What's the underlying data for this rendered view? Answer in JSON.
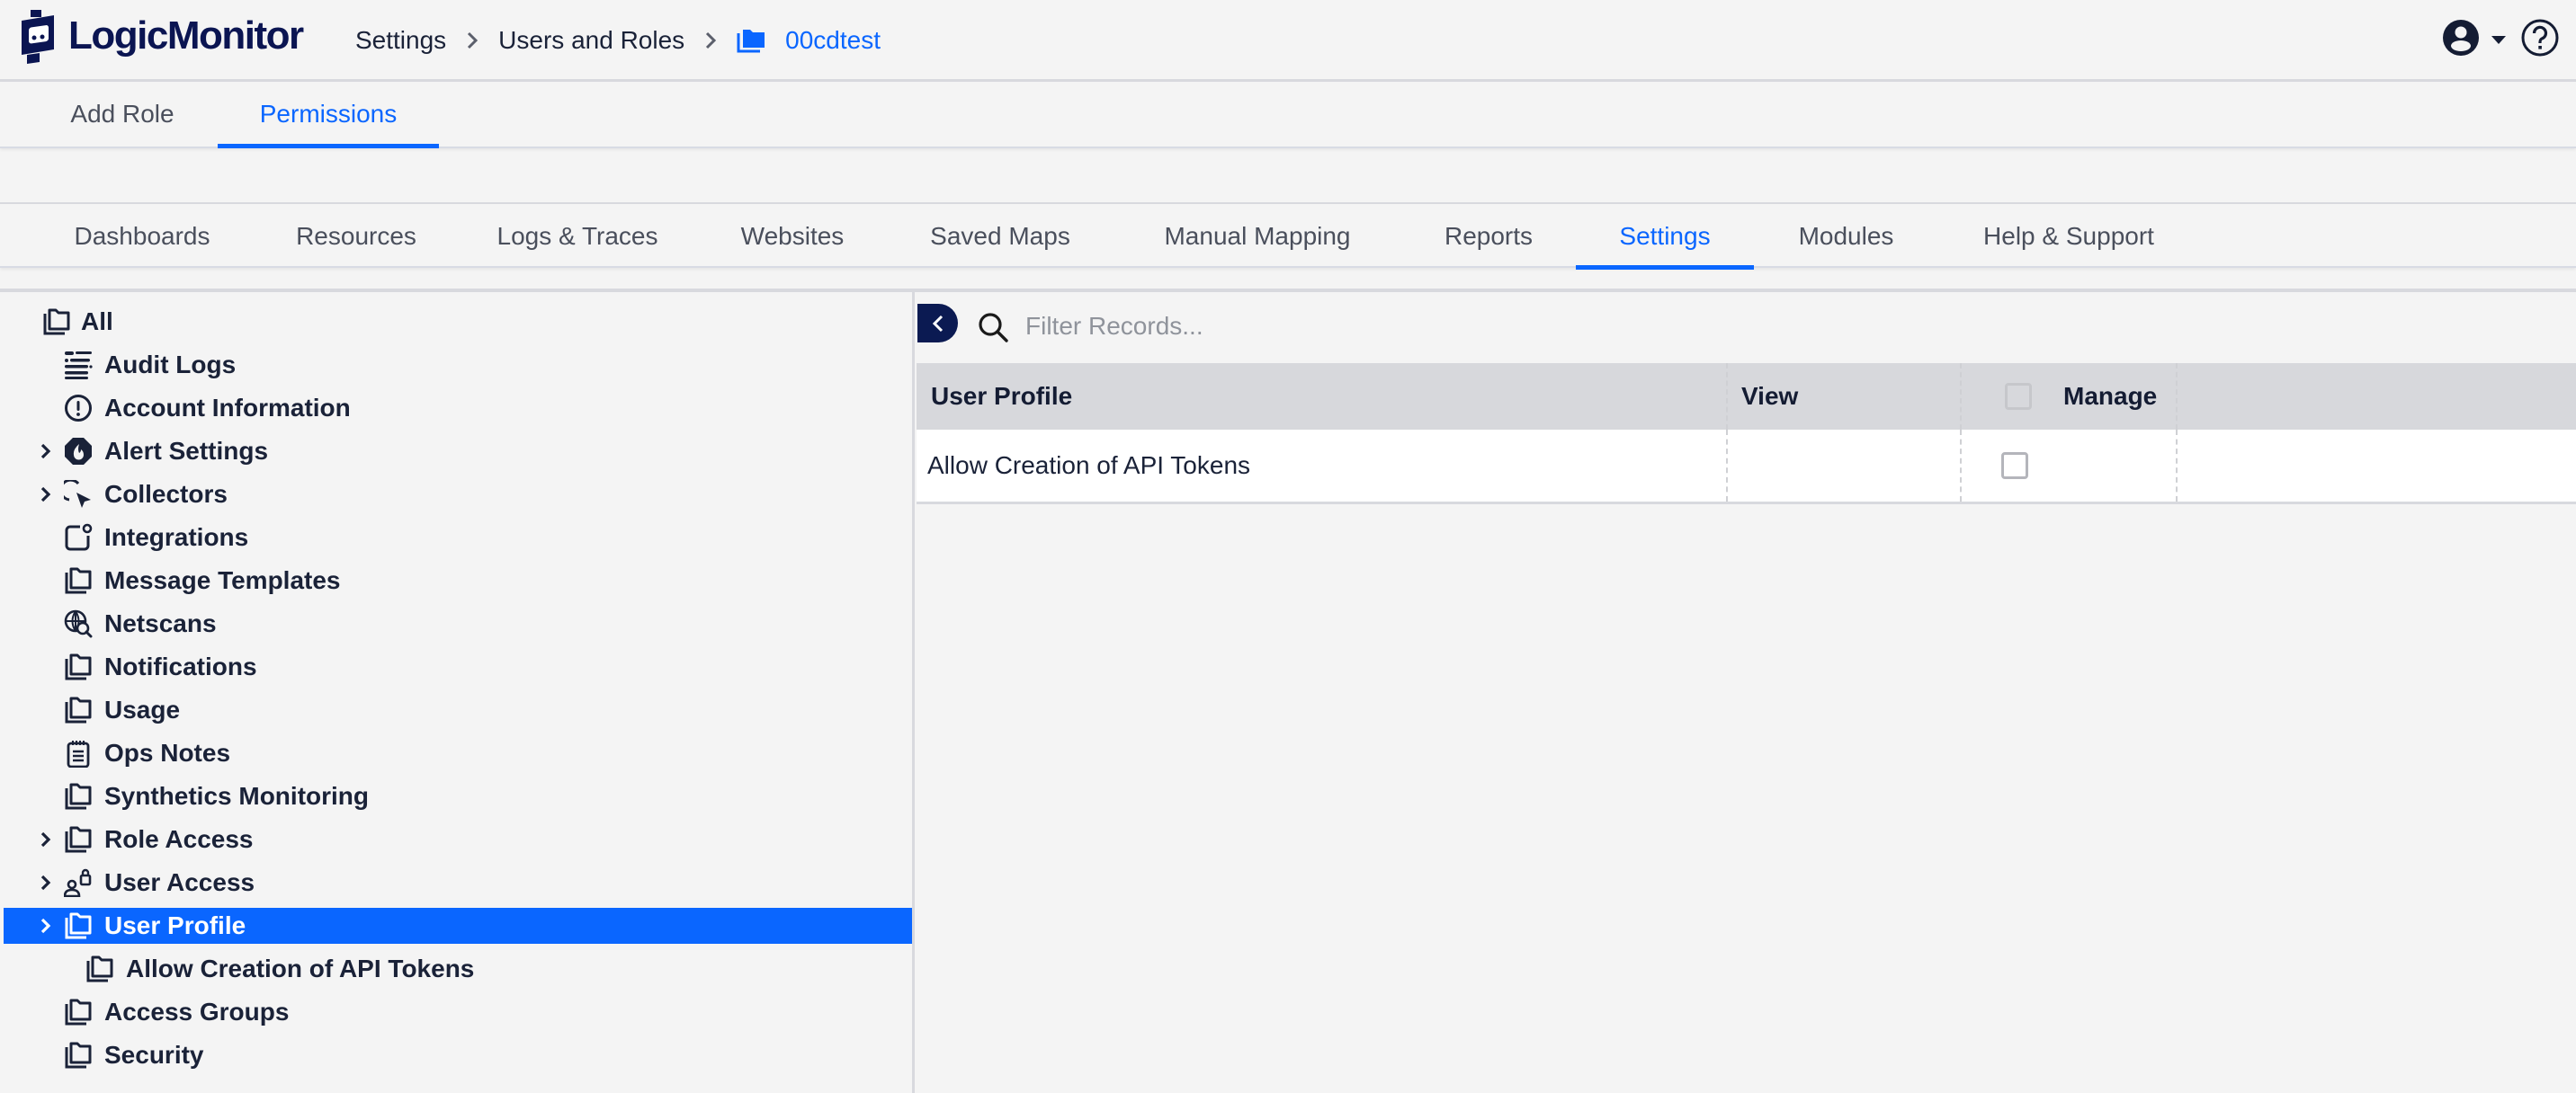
{
  "app": {
    "logo_text": "LogicMonitor"
  },
  "breadcrumb": [
    {
      "label": "Settings"
    },
    {
      "label": "Users and Roles"
    },
    {
      "label": "00cdtest",
      "icon": "folder-icon",
      "current": true
    }
  ],
  "header_right": {
    "user_icon": "user-circle-icon",
    "dropdown_icon": "caret-down-icon",
    "help_icon": "help-circle-icon"
  },
  "subtabs": [
    {
      "label": "Add Role",
      "active": false
    },
    {
      "label": "Permissions",
      "active": true
    }
  ],
  "category_tabs": [
    {
      "label": "Dashboards",
      "active": false
    },
    {
      "label": "Resources",
      "active": false
    },
    {
      "label": "Logs & Traces",
      "active": false
    },
    {
      "label": "Websites",
      "active": false
    },
    {
      "label": "Saved Maps",
      "active": false
    },
    {
      "label": "Manual Mapping",
      "active": false
    },
    {
      "label": "Reports",
      "active": false
    },
    {
      "label": "Settings",
      "active": true
    },
    {
      "label": "Modules",
      "active": false
    },
    {
      "label": "Help & Support",
      "active": false
    }
  ],
  "tree": {
    "items": [
      {
        "label": "All",
        "icon": "folder-stack-icon",
        "level": 0,
        "expandable": false
      },
      {
        "label": "Audit Logs",
        "icon": "audit-log-icon",
        "level": 1,
        "expandable": false
      },
      {
        "label": "Account Information",
        "icon": "info-exclamation-icon",
        "level": 1,
        "expandable": false
      },
      {
        "label": "Alert Settings",
        "icon": "alert-octagon-icon",
        "level": 1,
        "expandable": true
      },
      {
        "label": "Collectors",
        "icon": "collector-cursor-icon",
        "level": 1,
        "expandable": true
      },
      {
        "label": "Integrations",
        "icon": "integration-icon",
        "level": 1,
        "expandable": false
      },
      {
        "label": "Message Templates",
        "icon": "folder-stack-icon",
        "level": 1,
        "expandable": false
      },
      {
        "label": "Netscans",
        "icon": "globe-search-icon",
        "level": 1,
        "expandable": false
      },
      {
        "label": "Notifications",
        "icon": "folder-stack-icon",
        "level": 1,
        "expandable": false
      },
      {
        "label": "Usage",
        "icon": "folder-stack-icon",
        "level": 1,
        "expandable": false
      },
      {
        "label": "Ops Notes",
        "icon": "notepad-icon",
        "level": 1,
        "expandable": false
      },
      {
        "label": "Synthetics Monitoring",
        "icon": "folder-stack-icon",
        "level": 1,
        "expandable": false
      },
      {
        "label": "Role Access",
        "icon": "folder-stack-icon",
        "level": 1,
        "expandable": true
      },
      {
        "label": "User Access",
        "icon": "user-lock-icon",
        "level": 1,
        "expandable": true
      },
      {
        "label": "User Profile",
        "icon": "folder-stack-icon",
        "level": 1,
        "expandable": true,
        "selected": true
      },
      {
        "label": "Allow Creation of API Tokens",
        "icon": "folder-stack-icon",
        "level": 2,
        "expandable": false
      },
      {
        "label": "Access Groups",
        "icon": "folder-stack-icon",
        "level": 1,
        "expandable": false
      },
      {
        "label": "Security",
        "icon": "folder-stack-icon",
        "level": 1,
        "expandable": false
      }
    ]
  },
  "filter": {
    "placeholder": "Filter Records...",
    "value": ""
  },
  "table": {
    "columns": [
      "User Profile",
      "View",
      "Manage"
    ],
    "rows": [
      {
        "name": "Allow Creation of API Tokens",
        "view": null,
        "manage": false
      }
    ],
    "manage_header_checked": false
  },
  "colors": {
    "accent": "#0a66ff",
    "brand_navy": "#0b1552",
    "text": "#1a2238"
  }
}
